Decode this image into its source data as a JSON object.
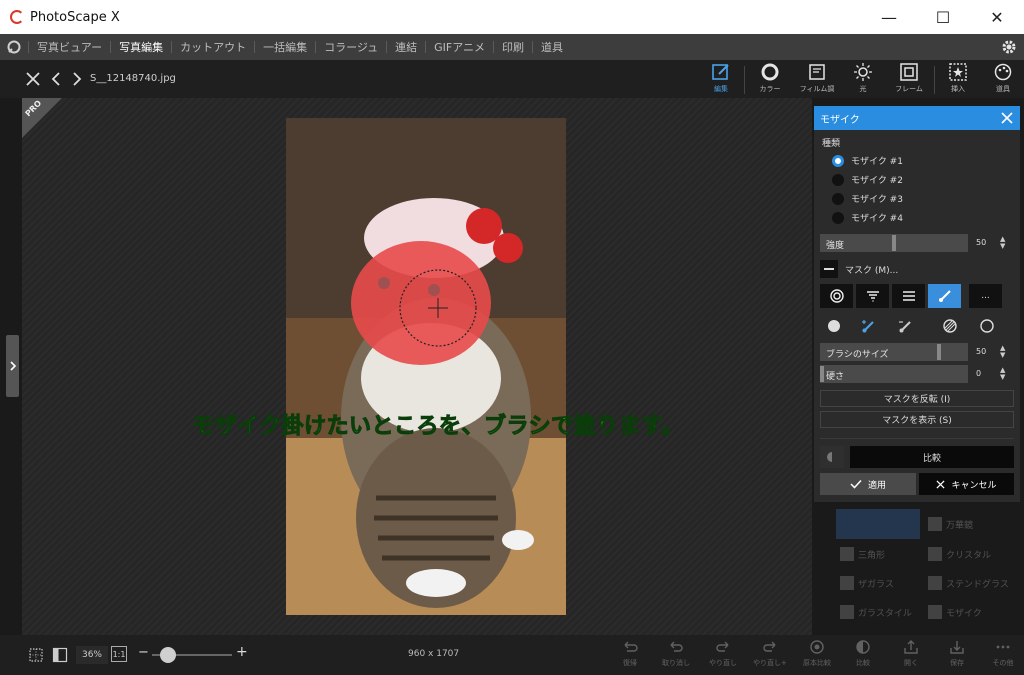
{
  "window": {
    "app_title": "PhotoScape X",
    "minimize": "—",
    "maximize": "☐",
    "close": "✕"
  },
  "menubar": {
    "items": [
      "写真ビュアー",
      "写真編集",
      "カットアウト",
      "一括編集",
      "コラージュ",
      "連結",
      "GIFアニメ",
      "印刷",
      "道具"
    ],
    "active_index": 1
  },
  "toolbar": {
    "filename": "S__12148740.jpg",
    "tools": [
      {
        "label": "編集",
        "icon": "edit-icon",
        "active": true
      },
      {
        "label": "カラー",
        "icon": "color-icon"
      },
      {
        "label": "フィルム調",
        "icon": "film-icon"
      },
      {
        "label": "光",
        "icon": "light-icon"
      },
      {
        "label": "フレーム",
        "icon": "frame-icon"
      },
      {
        "label": "挿入",
        "icon": "insert-icon"
      },
      {
        "label": "道具",
        "icon": "tools-icon"
      }
    ]
  },
  "canvas": {
    "badge": "PRO",
    "caption": "モザイク掛けたいところを、ブラシで塗ります。"
  },
  "panel": {
    "title": "モザイク",
    "type_label": "種類",
    "types": [
      "モザイク #1",
      "モザイク #2",
      "モザイク #3",
      "モザイク #4"
    ],
    "selected_type": 0,
    "strength": {
      "label": "強度",
      "value": "50",
      "fraction": 0.5
    },
    "mask_label": "マスク (M)...",
    "more_label": "...",
    "brush_size": {
      "label": "ブラシのサイズ",
      "value": "50",
      "fraction": 0.81
    },
    "hardness": {
      "label": "硬さ",
      "value": "0",
      "fraction": 0.0
    },
    "invert_mask": "マスクを反転 (I)",
    "show_mask": "マスクを表示 (S)",
    "compare": "比較",
    "apply": "適用",
    "cancel": "キャンセル",
    "accent_color": "#2b8de0"
  },
  "filters": {
    "items": [
      "万華鏡",
      "三角形",
      "クリスタル",
      "ザガラス",
      "ステンドグラス",
      "ガラスタイル",
      "モザイク"
    ]
  },
  "bottombar": {
    "zoom": "36%",
    "one_to_one": "1:1",
    "zoom_fraction": 0.2,
    "dimensions": "960 x 1707",
    "actions": [
      "復帰",
      "取り消し",
      "やり直し",
      "やり直し+",
      "原本比較",
      "比較",
      "開く",
      "保存",
      "その他"
    ]
  }
}
